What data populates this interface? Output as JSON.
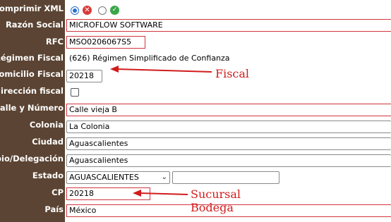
{
  "labels": {
    "comprimir_xml": "Comprimir XML",
    "razon_social": "Razón Social",
    "rfc": "RFC",
    "regimen_fiscal": "Régimen Fiscal",
    "domicilio_fiscal": "Domicilio Fiscal",
    "direccion_fiscal": "dirección fiscal",
    "calle_numero": "Calle y Número",
    "colonia": "Colonia",
    "ciudad": "Ciudad",
    "municipio": "pio/Delegación",
    "estado": "Estado",
    "cp": "CP",
    "pais": "País"
  },
  "fields": {
    "razon_social": "MICROFLOW SOFTWARE",
    "rfc": "MSO0206067S5",
    "regimen_fiscal": "(626) Régimen Simplificado de Confianza",
    "domicilio_fiscal": "20218",
    "calle_numero": "Calle vieja B",
    "colonia": "La Colonia",
    "ciudad": "Aguascalientes",
    "municipio": "Aguascalientes",
    "estado": "AGUASCALIENTES",
    "estado_extra": "",
    "cp": "20218",
    "pais": "México"
  },
  "annotations": {
    "fiscal": "Fiscal",
    "sucursal": "Sucursal",
    "bodega": "Bodega"
  },
  "icons": {
    "reject": "x-circle-icon",
    "accept": "check-circle-icon",
    "dropdown": "chevron-down-icon"
  },
  "colors": {
    "label_background": "#5b4433",
    "field_border_red": "#d0353d",
    "annotation_red": "#d11c1c"
  }
}
